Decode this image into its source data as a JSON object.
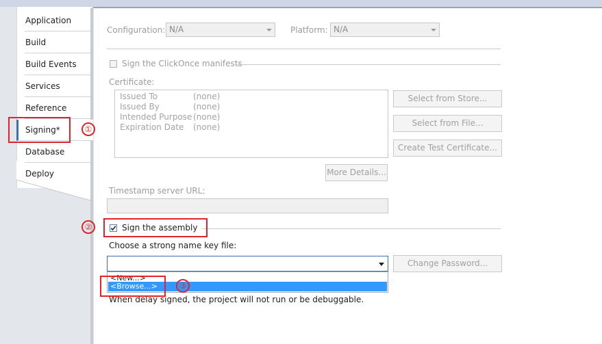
{
  "nav": {
    "items": [
      {
        "label": "Application"
      },
      {
        "label": "Build"
      },
      {
        "label": "Build Events"
      },
      {
        "label": "Services"
      },
      {
        "label": "Reference Paths"
      },
      {
        "label": "Signing*"
      },
      {
        "label": "Database"
      },
      {
        "label": "Deploy"
      }
    ],
    "selected": "Signing*"
  },
  "toolbar": {
    "configuration_label": "Configuration:",
    "configuration_value": "N/A",
    "platform_label": "Platform:",
    "platform_value": "N/A"
  },
  "clickonce": {
    "checkbox_label": "Sign the ClickOnce manifests",
    "checked": false,
    "certificate_label": "Certificate:",
    "rows": [
      {
        "key": "Issued To",
        "value": "(none)"
      },
      {
        "key": "Issued By",
        "value": "(none)"
      },
      {
        "key": "Intended Purpose",
        "value": "(none)"
      },
      {
        "key": "Expiration Date",
        "value": "(none)"
      }
    ],
    "select_from_store": "Select from Store...",
    "select_from_file": "Select from File...",
    "create_test_certificate": "Create Test Certificate...",
    "more_details": "More Details...",
    "timestamp_label": "Timestamp server URL:",
    "timestamp_value": ""
  },
  "assembly": {
    "checkbox_label": "Sign the assembly",
    "checked": true,
    "key_file_label": "Choose a strong name key file:",
    "key_file_value": "",
    "change_password": "Change Password...",
    "dropdown_options": [
      "<New...>",
      "<Browse...>"
    ],
    "highlighted_option": "<Browse...>",
    "delay_note": "When delay signed, the project will not run or be debuggable."
  },
  "annotations": {
    "marker_1": "①",
    "marker_2": "②",
    "marker_3": "③",
    "color": "#e0242a"
  }
}
